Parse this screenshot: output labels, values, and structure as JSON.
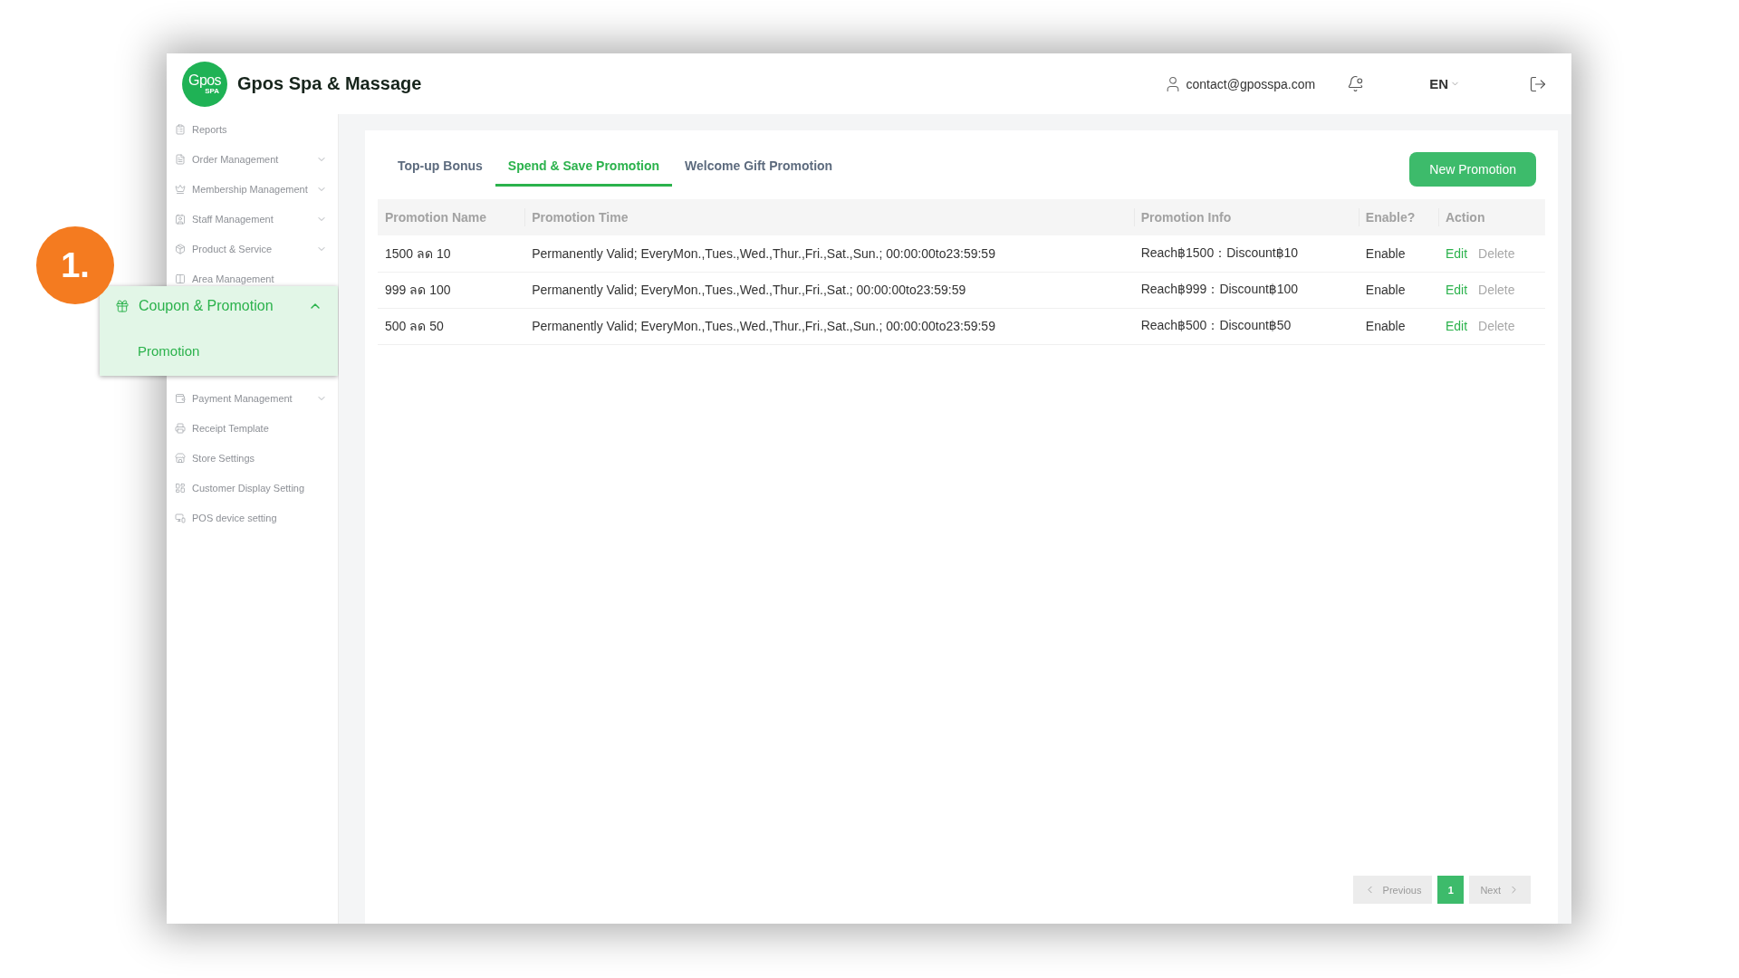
{
  "header": {
    "logo": {
      "text": "Gpos",
      "subtext": "SPA"
    },
    "title": "Gpos Spa & Massage",
    "user_email": "contact@gposspa.com",
    "language": "EN"
  },
  "sidebar": {
    "items": [
      {
        "label": "Reports",
        "kind": "page"
      },
      {
        "label": "Order Management",
        "kind": "group",
        "expanded": false
      },
      {
        "label": "Membership Management",
        "kind": "group",
        "expanded": false
      },
      {
        "label": "Staff Management",
        "kind": "group",
        "expanded": false
      },
      {
        "label": "Product & Service",
        "kind": "group",
        "expanded": false
      },
      {
        "label": "Area Management",
        "kind": "page"
      },
      {
        "label": "Coupon & Promotion",
        "kind": "group",
        "expanded": true,
        "children": [
          {
            "label": "Promotion",
            "selected": true
          }
        ]
      },
      {
        "label": "Payment Management",
        "kind": "group",
        "expanded": false
      },
      {
        "label": "Receipt Template",
        "kind": "page"
      },
      {
        "label": "Store Settings",
        "kind": "page"
      },
      {
        "label": "Customer Display Setting",
        "kind": "page"
      },
      {
        "label": "POS device setting",
        "kind": "page"
      }
    ]
  },
  "step_badge": "1.",
  "tabs": [
    {
      "label": "Top-up Bonus",
      "selected": false
    },
    {
      "label": "Spend & Save Promotion",
      "selected": true
    },
    {
      "label": "Welcome Gift Promotion",
      "selected": false
    }
  ],
  "new_button": "New Promotion",
  "table": {
    "columns": [
      "Promotion Name",
      "Promotion Time",
      "Promotion Info",
      "Enable?",
      "Action"
    ],
    "rows": [
      {
        "name": "1500 ลด 10",
        "time": "Permanently Valid; EveryMon.,Tues.,Wed.,Thur.,Fri.,Sat.,Sun.; 00:00:00to23:59:59",
        "info": "Reach฿1500：Discount฿10",
        "status": "Enable",
        "actions": [
          {
            "label": "Edit",
            "kind": "edit"
          },
          {
            "label": "Delete",
            "kind": "delete"
          }
        ]
      },
      {
        "name": "999 ลด 100",
        "time": "Permanently Valid; EveryMon.,Tues.,Wed.,Thur.,Fri.,Sat.; 00:00:00to23:59:59",
        "info": "Reach฿999：Discount฿100",
        "status": "Enable",
        "actions": [
          {
            "label": "Edit",
            "kind": "edit"
          },
          {
            "label": "Delete",
            "kind": "delete"
          }
        ]
      },
      {
        "name": "500 ลด 50",
        "time": "Permanently Valid; EveryMon.,Tues.,Wed.,Thur.,Fri.,Sat.,Sun.; 00:00:00to23:59:59",
        "info": "Reach฿500：Discount฿50",
        "status": "Enable",
        "actions": [
          {
            "label": "Edit",
            "kind": "edit"
          },
          {
            "label": "Delete",
            "kind": "delete"
          }
        ]
      }
    ]
  },
  "pagination": {
    "previous": {
      "label": "Previous",
      "disabled": true
    },
    "pages": [
      {
        "label": "1",
        "selected": true
      }
    ],
    "next": {
      "label": "Next",
      "disabled": true
    }
  }
}
